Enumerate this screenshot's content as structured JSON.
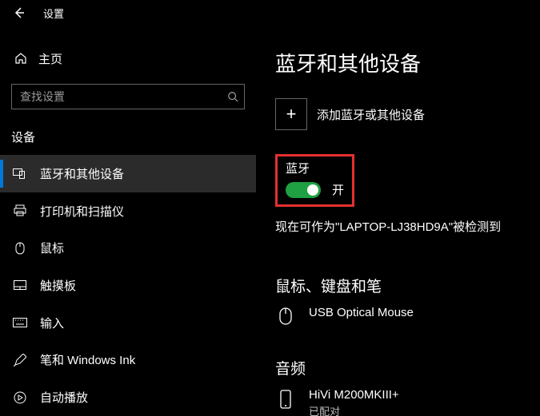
{
  "header": {
    "title": "设置"
  },
  "sidebar": {
    "home": "主页",
    "searchPlaceholder": "查找设置",
    "group": "设备",
    "items": [
      {
        "label": "蓝牙和其他设备"
      },
      {
        "label": "打印机和扫描仪"
      },
      {
        "label": "鼠标"
      },
      {
        "label": "触摸板"
      },
      {
        "label": "输入"
      },
      {
        "label": "笔和 Windows Ink"
      },
      {
        "label": "自动播放"
      }
    ]
  },
  "main": {
    "title": "蓝牙和其他设备",
    "addDevice": "添加蓝牙或其他设备",
    "bluetooth": {
      "heading": "蓝牙",
      "state": "开"
    },
    "discoverable": "现在可作为\"LAPTOP-LJ38HD9A\"被检测到",
    "mouseSection": "鼠标、键盘和笔",
    "mouseDevice": "USB Optical Mouse",
    "audioSection": "音频",
    "audioDevice": {
      "name": "HiVi M200MKIII+",
      "status": "已配对"
    }
  }
}
